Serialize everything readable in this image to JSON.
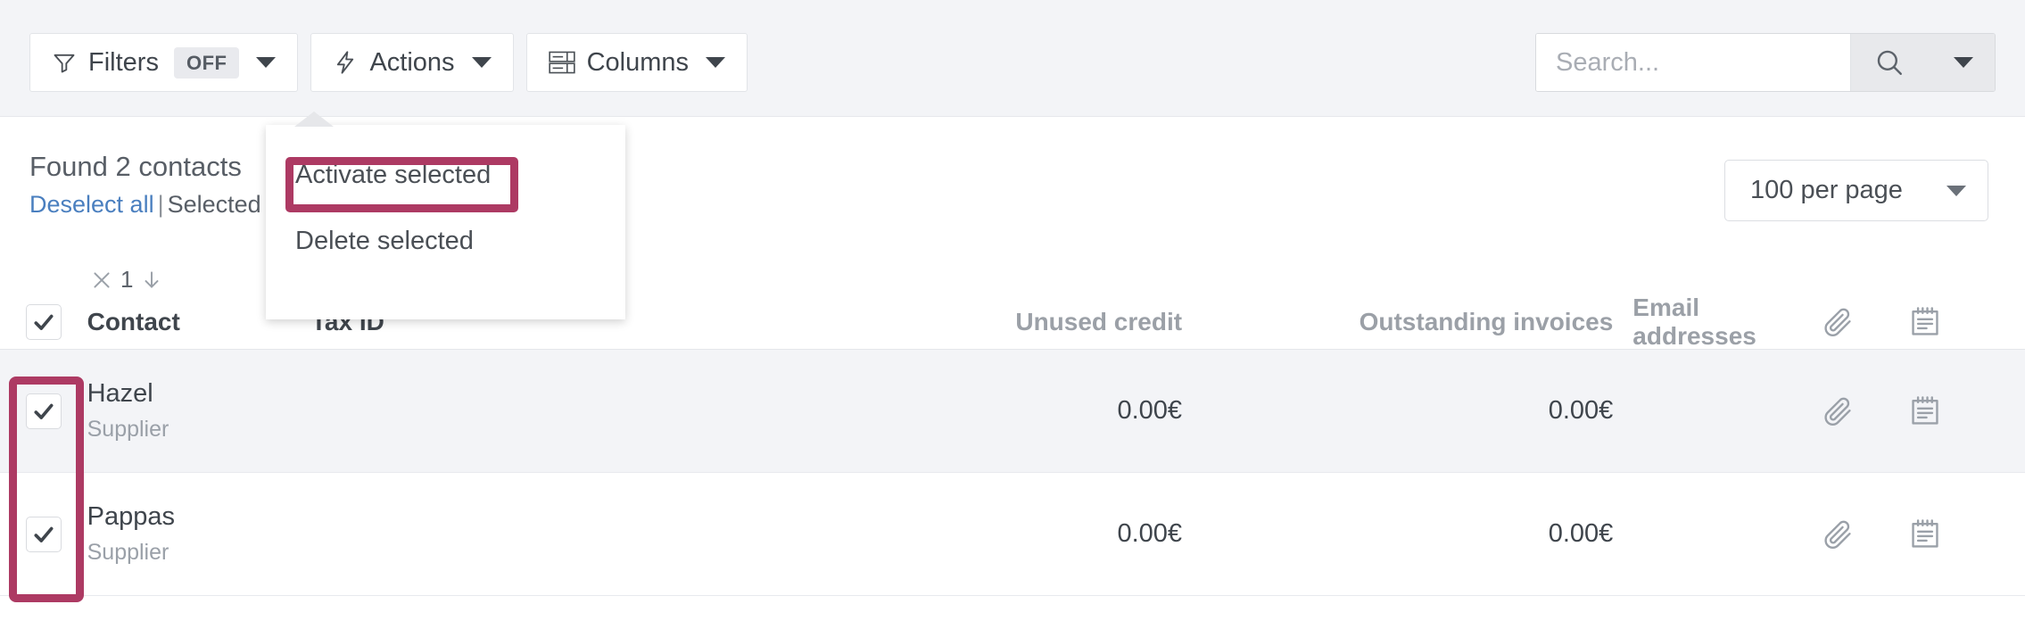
{
  "toolbar": {
    "filters": {
      "label": "Filters",
      "state": "OFF",
      "icon": "funnel-icon"
    },
    "actions": {
      "label": "Actions",
      "icon": "lightning-bolt-icon"
    },
    "columns": {
      "label": "Columns",
      "icon": "columns-icon"
    },
    "search": {
      "placeholder": "Search...",
      "value": "",
      "icon": "search-icon"
    }
  },
  "results": {
    "found_label": "Found 2 contacts",
    "deselect_label": "Deselect all",
    "separator": "|",
    "selected_label": "Selected re",
    "per_page": "100 per page"
  },
  "actions_menu": {
    "items": [
      {
        "label": "Activate selected",
        "highlighted": true
      },
      {
        "label": "Delete selected",
        "highlighted": false
      }
    ]
  },
  "sort": {
    "clear_icon": "close-x-icon",
    "index": "1",
    "direction_icon": "arrow-down-icon"
  },
  "table": {
    "columns": [
      {
        "key": "contact",
        "label": "Contact"
      },
      {
        "key": "tax_id",
        "label": "Tax ID"
      },
      {
        "key": "unused_credit",
        "label": "Unused credit"
      },
      {
        "key": "outstanding_invoices",
        "label": "Outstanding invoices"
      },
      {
        "key": "email_addresses",
        "label": "Email addresses"
      }
    ],
    "header_icons": [
      {
        "name": "paperclip-icon"
      },
      {
        "name": "notebook-icon"
      }
    ],
    "rows": [
      {
        "selected": true,
        "name": "Hazel",
        "role": "Supplier",
        "tax_id": "",
        "unused_credit": "0.00€",
        "outstanding_invoices": "0.00€",
        "email_addresses": ""
      },
      {
        "selected": true,
        "name": "Pappas",
        "role": "Supplier",
        "tax_id": "",
        "unused_credit": "0.00€",
        "outstanding_invoices": "0.00€",
        "email_addresses": ""
      }
    ]
  },
  "colors": {
    "highlight": "#ad3a63",
    "link": "#4a7fbf",
    "toolbar_bg": "#f3f4f7",
    "row_alt_bg": "#f3f4f7"
  }
}
